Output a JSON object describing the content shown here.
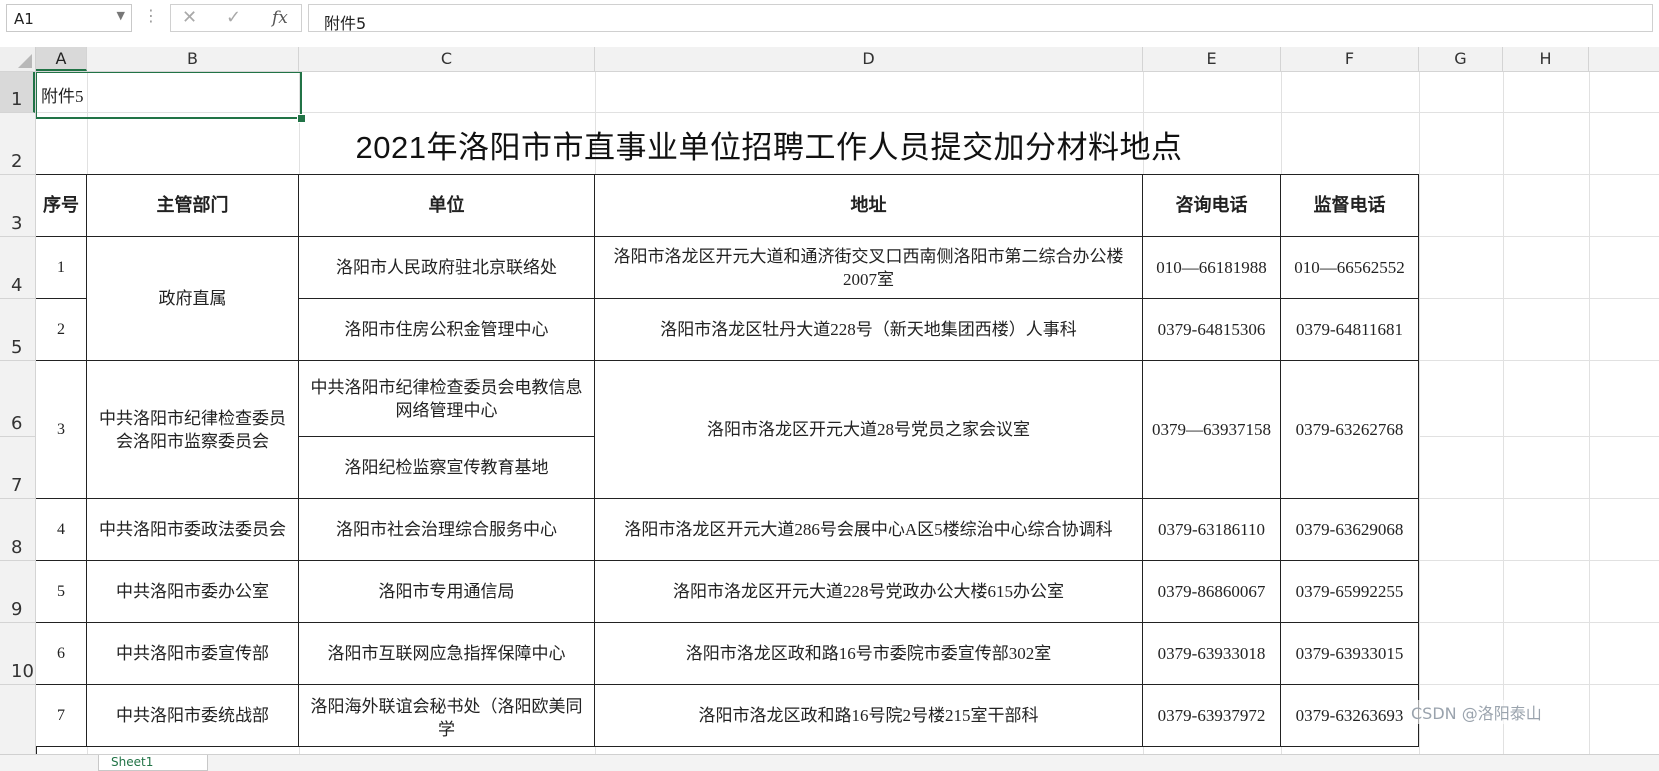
{
  "formula_bar": {
    "name_box": "A1",
    "cancel_icon": "✕",
    "enter_icon": "✓",
    "fx_label": "fx",
    "formula_value": "附件5"
  },
  "columns": [
    "A",
    "B",
    "C",
    "D",
    "E",
    "F",
    "G",
    "H"
  ],
  "rows": [
    "1",
    "2",
    "3",
    "4",
    "5",
    "6",
    "7",
    "8",
    "9",
    "10"
  ],
  "sheet": {
    "a1": "附件5",
    "title": "2021年洛阳市市直事业单位招聘工作人员提交加分材料地点",
    "headers": {
      "seq": "序号",
      "dept": "主管部门",
      "unit": "单位",
      "address": "地址",
      "consult_phone": "咨询电话",
      "supervise_phone": "监督电话"
    },
    "records": [
      {
        "seq": "1",
        "unit": "洛阳市人民政府驻北京联络处",
        "address": "洛阳市洛龙区开元大道和通济街交叉口西南侧洛阳市第二综合办公楼2007室",
        "consult": "010—66181988",
        "supervise": "010—66562552"
      },
      {
        "seq": "2",
        "unit": "洛阳市住房公积金管理中心",
        "address": "洛阳市洛龙区牡丹大道228号（新天地集团西楼）人事科",
        "consult": "0379-64815306",
        "supervise": "0379-64811681"
      },
      {
        "seq": "3",
        "unit_a": "中共洛阳市纪律检查委员会电教信息网络管理中心",
        "unit_b": "洛阳纪检监察宣传教育基地",
        "address": "洛阳市洛龙区开元大道28号党员之家会议室",
        "consult": "0379—63937158",
        "supervise": "0379-63262768"
      },
      {
        "seq": "4",
        "dept": "中共洛阳市委政法委员会",
        "unit": "洛阳市社会治理综合服务中心",
        "address": "洛阳市洛龙区开元大道286号会展中心A区5楼综治中心综合协调科",
        "consult": "0379-63186110",
        "supervise": "0379-63629068"
      },
      {
        "seq": "5",
        "dept": "中共洛阳市委办公室",
        "unit": "洛阳市专用通信局",
        "address": "洛阳市洛龙区开元大道228号党政办公大楼615办公室",
        "consult": "0379-86860067",
        "supervise": "0379-65992255"
      },
      {
        "seq": "6",
        "dept": "中共洛阳市委宣传部",
        "unit": "洛阳市互联网应急指挥保障中心",
        "address": "洛阳市洛龙区政和路16号市委院市委宣传部302室",
        "consult": "0379-63933018",
        "supervise": "0379-63933015"
      },
      {
        "seq": "7",
        "dept": "中共洛阳市委统战部",
        "unit": "洛阳海外联谊会秘书处（洛阳欧美同学",
        "address": "洛阳市洛龙区政和路16号院2号楼215室干部科",
        "consult": "0379-63937972",
        "supervise": "0379-63263693"
      }
    ],
    "dept_gov": "政府直属",
    "dept_discipline": "中共洛阳市纪律检查委员会洛阳市监察委员会"
  },
  "watermark": "CSDN @洛阳泰山",
  "sheet_tab": "Sheet1"
}
